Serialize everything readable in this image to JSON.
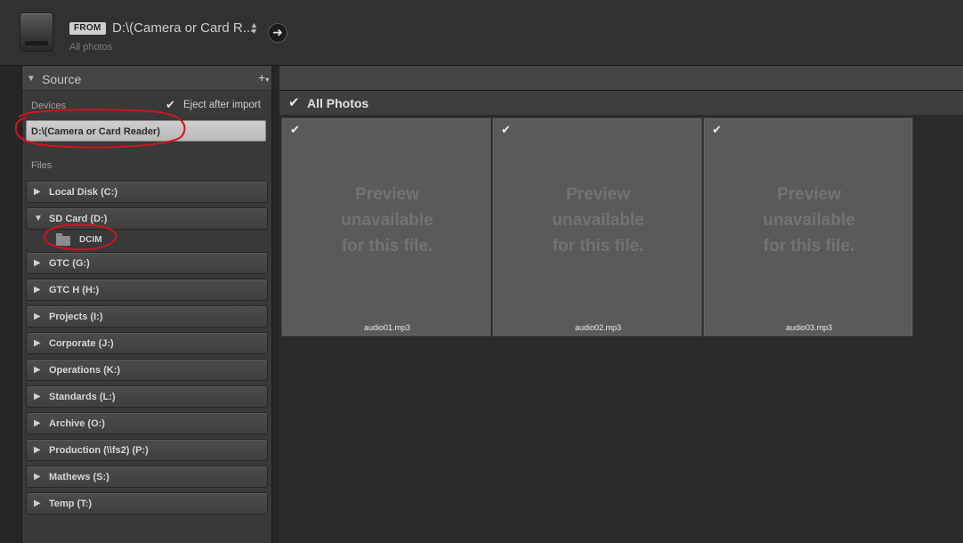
{
  "header": {
    "from_badge": "FROM",
    "source_path": "D:\\(Camera or Card R...",
    "source_sub": "All photos",
    "go_icon": "arrow-right-icon",
    "drive_icon": "drive-icon"
  },
  "source_panel": {
    "title": "Source",
    "add_icon": "plus-icon",
    "devices_label": "Devices",
    "eject_checked": true,
    "eject_label": "Eject after import",
    "device_name": "D:\\(Camera or Card Reader)",
    "files_label": "Files",
    "volumes": [
      {
        "label": "Local Disk (C:)",
        "expanded": false
      },
      {
        "label": "SD Card (D:)",
        "expanded": true
      },
      {
        "label": "GTC (G:)",
        "expanded": false
      },
      {
        "label": "GTC H (H:)",
        "expanded": false
      },
      {
        "label": "Projects (I:)",
        "expanded": false
      },
      {
        "label": "Corporate (J:)",
        "expanded": false
      },
      {
        "label": "Operations (K:)",
        "expanded": false
      },
      {
        "label": "Standards (L:)",
        "expanded": false
      },
      {
        "label": "Archive (O:)",
        "expanded": false
      },
      {
        "label": "Production (\\\\fs2) (P:)",
        "expanded": false
      },
      {
        "label": "Mathews (S:)",
        "expanded": false
      },
      {
        "label": "Temp (T:)",
        "expanded": false
      }
    ],
    "subfolder": "DCIM"
  },
  "main": {
    "all_photos_label": "All Photos",
    "all_checked": true,
    "thumbnails": [
      {
        "preview_line1": "Preview",
        "preview_line2": "unavailable",
        "preview_line3": "for this file.",
        "filename": "audio01.mp3",
        "checked": true
      },
      {
        "preview_line1": "Preview",
        "preview_line2": "unavailable",
        "preview_line3": "for this file.",
        "filename": "audio02.mp3",
        "checked": true
      },
      {
        "preview_line1": "Preview",
        "preview_line2": "unavailable",
        "preview_line3": "for this file.",
        "filename": "audio03.mp3",
        "checked": true
      }
    ]
  },
  "annotations": {
    "color": "#d0141b"
  }
}
